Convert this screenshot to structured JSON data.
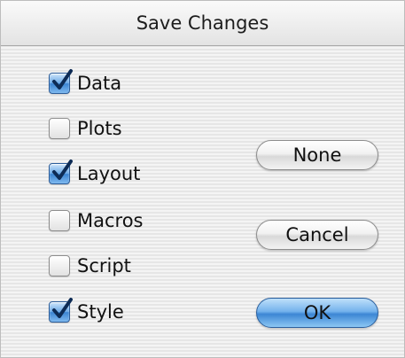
{
  "dialog": {
    "title": "Save Changes",
    "options": [
      {
        "label": "Data",
        "checked": true
      },
      {
        "label": "Plots",
        "checked": false
      },
      {
        "label": "Layout",
        "checked": true
      },
      {
        "label": "Macros",
        "checked": false
      },
      {
        "label": "Script",
        "checked": false
      },
      {
        "label": "Style",
        "checked": true
      }
    ],
    "buttons": {
      "none_label": "None",
      "cancel_label": "Cancel",
      "ok_label": "OK"
    }
  },
  "colors": {
    "accent_aqua": "#3c86d4",
    "stripe_light": "#f4f4f4",
    "stripe_dark": "#e6e6e6"
  }
}
